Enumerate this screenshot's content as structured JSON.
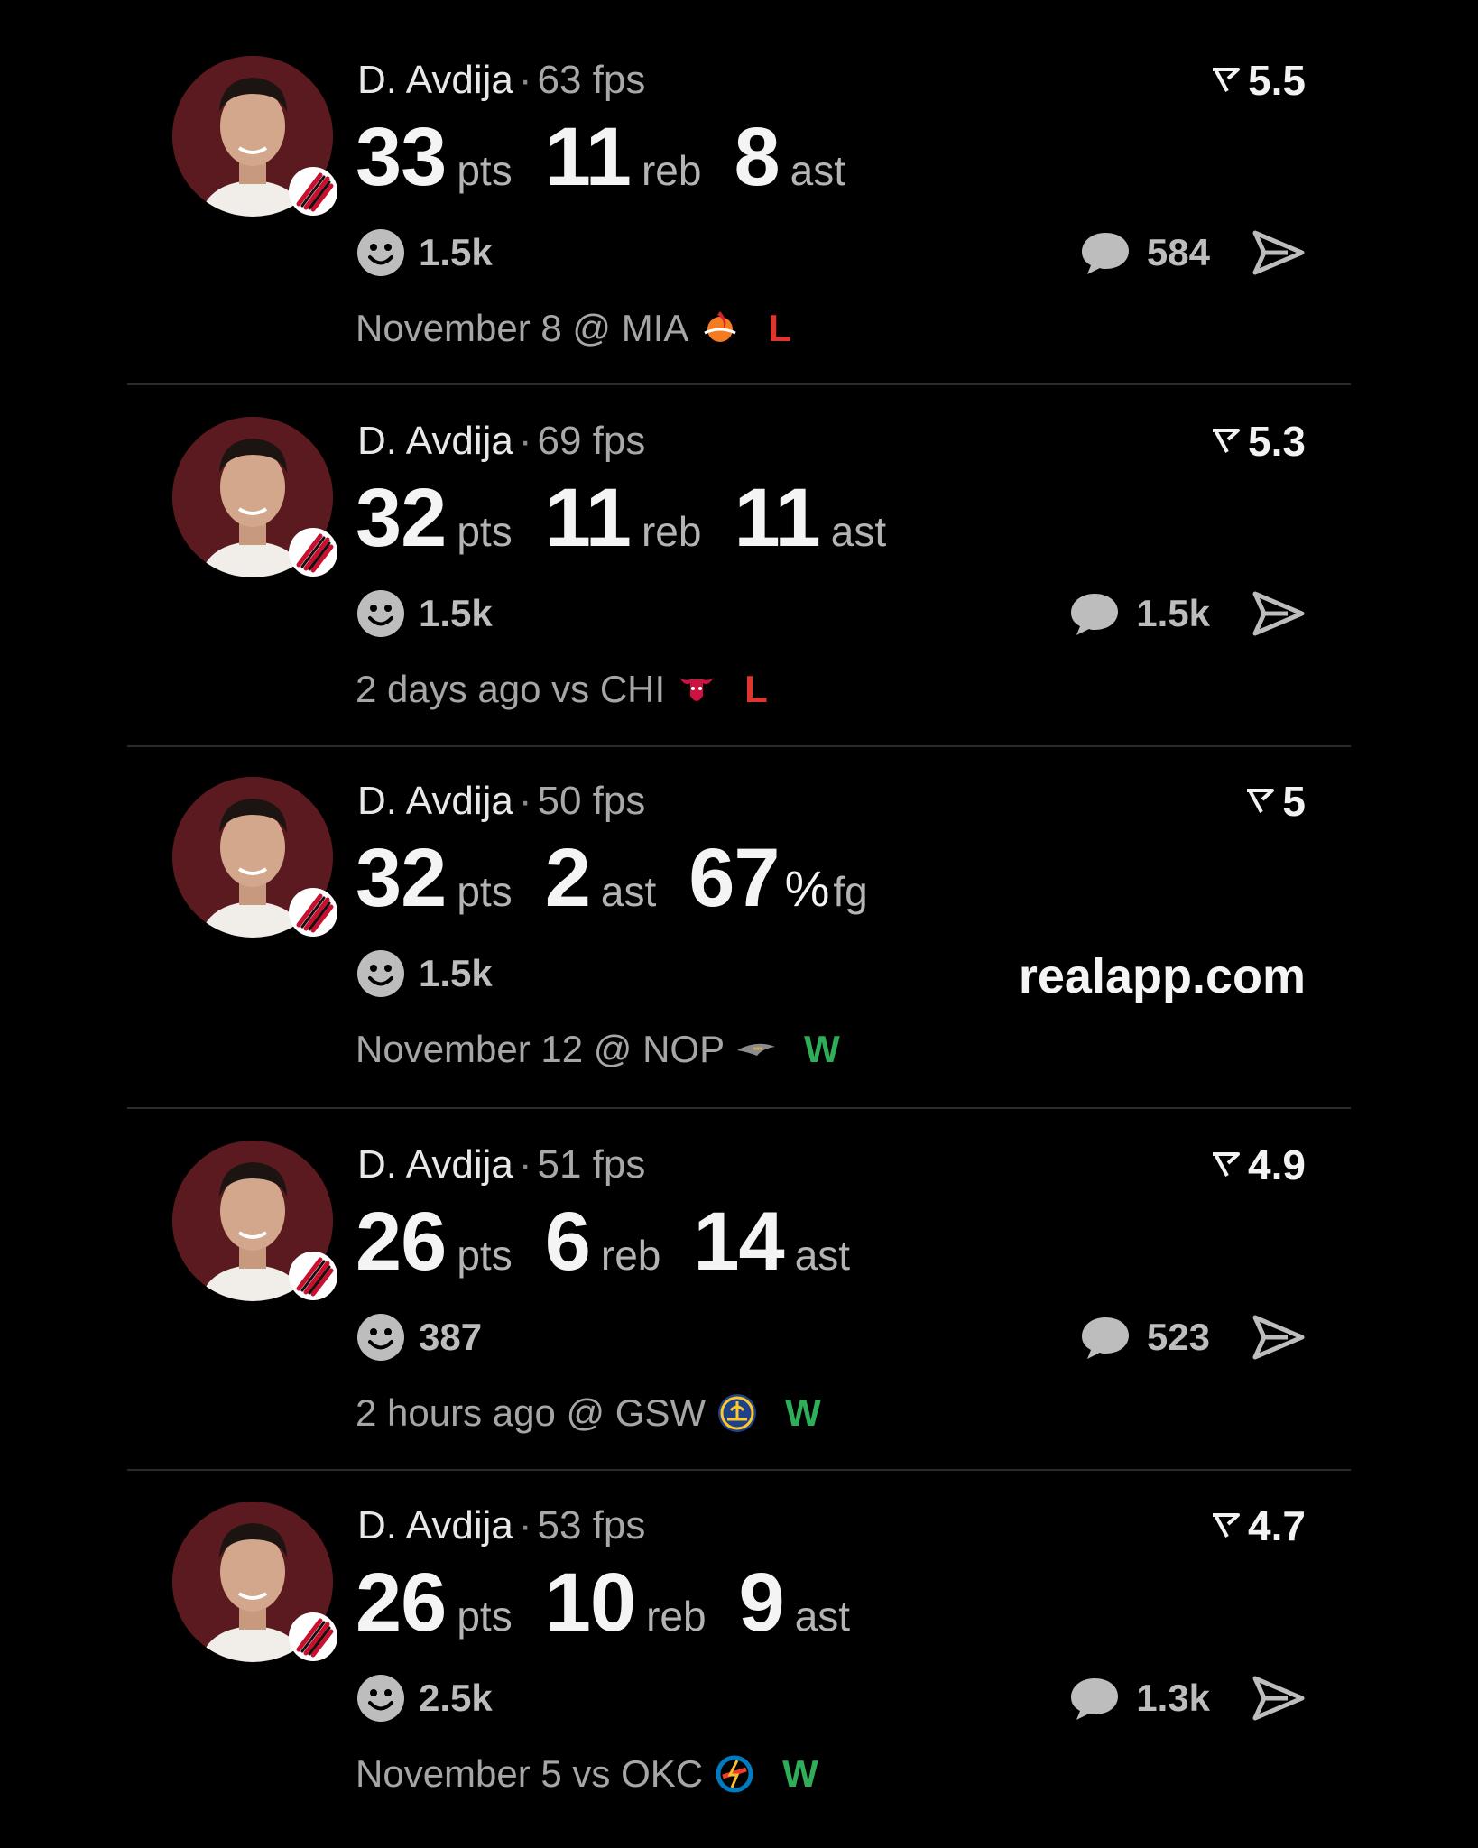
{
  "colors": {
    "background": "#000000",
    "loss": "#e0342f",
    "win": "#2fae5a",
    "muted": "#a6a6a6",
    "avatar_bg": "#5a1a1f"
  },
  "separator": "·",
  "posts": [
    {
      "player": "D. Avdija",
      "fps": "63 fps",
      "score": "5.5",
      "stats": [
        {
          "value": "33",
          "unit": "pts"
        },
        {
          "value": "11",
          "unit": "reb"
        },
        {
          "value": "8",
          "unit": "ast"
        }
      ],
      "reactions": "1.5k",
      "comments": "584",
      "game": "November 8 @ MIA",
      "opponent_icon": "heat-logo-icon",
      "result": "L"
    },
    {
      "player": "D. Avdija",
      "fps": "69 fps",
      "score": "5.3",
      "stats": [
        {
          "value": "32",
          "unit": "pts"
        },
        {
          "value": "11",
          "unit": "reb"
        },
        {
          "value": "11",
          "unit": "ast"
        }
      ],
      "reactions": "1.5k",
      "comments": "1.5k",
      "game": "2 days ago vs CHI",
      "opponent_icon": "bulls-logo-icon",
      "result": "L"
    },
    {
      "player": "D. Avdija",
      "fps": "50 fps",
      "score": "5",
      "stats": [
        {
          "value": "32",
          "unit": "pts"
        },
        {
          "value": "2",
          "unit": "ast"
        },
        {
          "value": "67",
          "pct": "%",
          "unit": "fg"
        }
      ],
      "reactions": "1.5k",
      "watermark": "realapp.com",
      "game": "November 12 @ NOP",
      "opponent_icon": "pelicans-logo-icon",
      "result": "W"
    },
    {
      "player": "D. Avdija",
      "fps": "51 fps",
      "score": "4.9",
      "stats": [
        {
          "value": "26",
          "unit": "pts"
        },
        {
          "value": "6",
          "unit": "reb"
        },
        {
          "value": "14",
          "unit": "ast"
        }
      ],
      "reactions": "387",
      "comments": "523",
      "game": "2 hours ago @ GSW",
      "opponent_icon": "warriors-logo-icon",
      "result": "W"
    },
    {
      "player": "D. Avdija",
      "fps": "53 fps",
      "score": "4.7",
      "stats": [
        {
          "value": "26",
          "unit": "pts"
        },
        {
          "value": "10",
          "unit": "reb"
        },
        {
          "value": "9",
          "unit": "ast"
        }
      ],
      "reactions": "2.5k",
      "comments": "1.3k",
      "game": "November 5 vs OKC",
      "opponent_icon": "thunder-logo-icon",
      "result": "W"
    }
  ]
}
